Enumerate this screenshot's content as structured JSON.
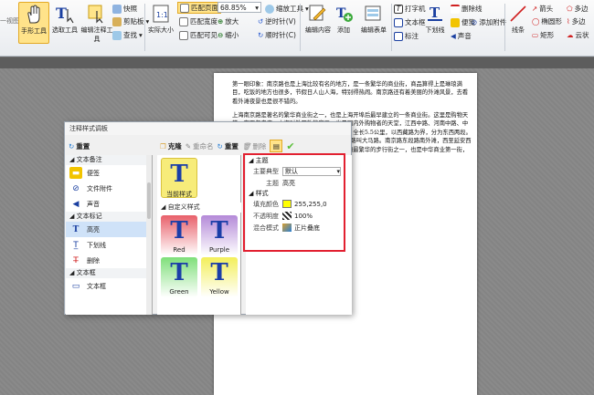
{
  "ribbon": {
    "view_label": "一视图",
    "hand_tool": "手形工具",
    "select_tool": "选取工具",
    "edit_annot_tool": "编辑注释工具",
    "snapshot": "快照",
    "clipboard": "剪贴板",
    "find": "查找",
    "actual_size": "实际大小",
    "fit_page": "匹配页面",
    "fit_width": "匹配宽度",
    "fit_visible": "匹配可见",
    "zoom_value": "68.85%",
    "zoom_tool": "缩放工具",
    "zoom_in": "放大",
    "zoom_out": "缩小",
    "rotate_ccw": "逆时针(V)",
    "rotate_cw": "顺时针(C)",
    "edit_content": "编辑内容",
    "add": "添加",
    "edit_form": "编辑表单",
    "typewriter": "打字机",
    "textbox": "文本框",
    "callout": "标注",
    "underline": "下划线",
    "strikeout": "删除线",
    "sound": "声音",
    "note": "便笺",
    "attach_file": "添加附件",
    "arrow": "箭头",
    "ellipse": "椭圆形",
    "rectangle": "矩形",
    "line": "线条",
    "polygon": "多边",
    "polyline": "多边",
    "cloud": "云状"
  },
  "document": {
    "para1": "第一眼印象：南京路也是上海比较有名的地方，是一条繁华的商业街，商品算得上是琳琅满目，吃饭的地方也很多，节假日人山人海，特别得热闹。南京路还有着美丽的外滩风景，去看看外滩夜景也是很不错的。",
    "para2": "上海南京路是著名的繁华商业街之一，也是上海开埠后最早建立的一条商业街。这里是购物天堂，有百年老店，上海对外开放的窗口，也是国内外购物者的天堂，江西中路、河南中路、中山东一路等纵横交错，是国内外知名的步行街，全长5.5公里，以西藏路为界，分为东西两段。南京路上海十大商业中心，1945年以前的南京路叫大马路。南京路东段路南外滩，西至延安西路，南京路步行街就是南京路的一部分，是亚洲最繁华的步行街之一，也是中华商业第一街，东至外滩，西面连接着静安寺，南京路的东部。"
  },
  "dialog": {
    "title": "注释样式调板",
    "reset": "重置",
    "clone": "克隆",
    "rename": "重命名",
    "reset2": "重置",
    "delete": "删除",
    "categories": [
      {
        "label": "文本备注",
        "items": [
          {
            "icon": "note-icon",
            "label": "便签",
            "color": "#f2c400"
          },
          {
            "icon": "paperclip-icon",
            "label": "文件附件",
            "color": "#1a3fa0"
          },
          {
            "icon": "speaker-icon",
            "label": "声音",
            "color": "#1a3fa0"
          }
        ]
      },
      {
        "label": "文本标记",
        "items": [
          {
            "icon": "highlight-icon",
            "label": "高亮",
            "color": "#1a3fa0",
            "selected": true
          },
          {
            "icon": "underline-icon",
            "label": "下划线",
            "color": "#1a3fa0"
          },
          {
            "icon": "strikeout-icon",
            "label": "删除",
            "color": "#d02020"
          }
        ]
      },
      {
        "label": "文本框",
        "items": [
          {
            "icon": "textbox-icon",
            "label": "文本框",
            "color": "#1a3fa0"
          }
        ]
      }
    ],
    "current_style": "当前样式",
    "custom_styles_label": "自定义样式",
    "tiles": [
      {
        "label": "Red",
        "bg": "#e8606a",
        "t": "#1b3ea8"
      },
      {
        "label": "Purple",
        "bg": "#b48ad8",
        "t": "#1b3ea8"
      },
      {
        "label": "Green",
        "bg": "#7fdf7a",
        "t": "#1b3ea8"
      },
      {
        "label": "Yellow",
        "bg": "#f3ef5a",
        "t": "#1b3ea8"
      }
    ],
    "props": {
      "theme_section": "主题",
      "theme_label": "主要典型",
      "theme_value": "默认",
      "theme_sub_label": "主题",
      "theme_sub_value": "高亮",
      "style_section": "样式",
      "fill_label": "填充颜色",
      "fill_value": "255,255,0",
      "fill_color": "#ffff00",
      "opacity_label": "不透明度",
      "opacity_value": "100%",
      "blend_label": "混合模式",
      "blend_value": "正片叠底"
    }
  }
}
